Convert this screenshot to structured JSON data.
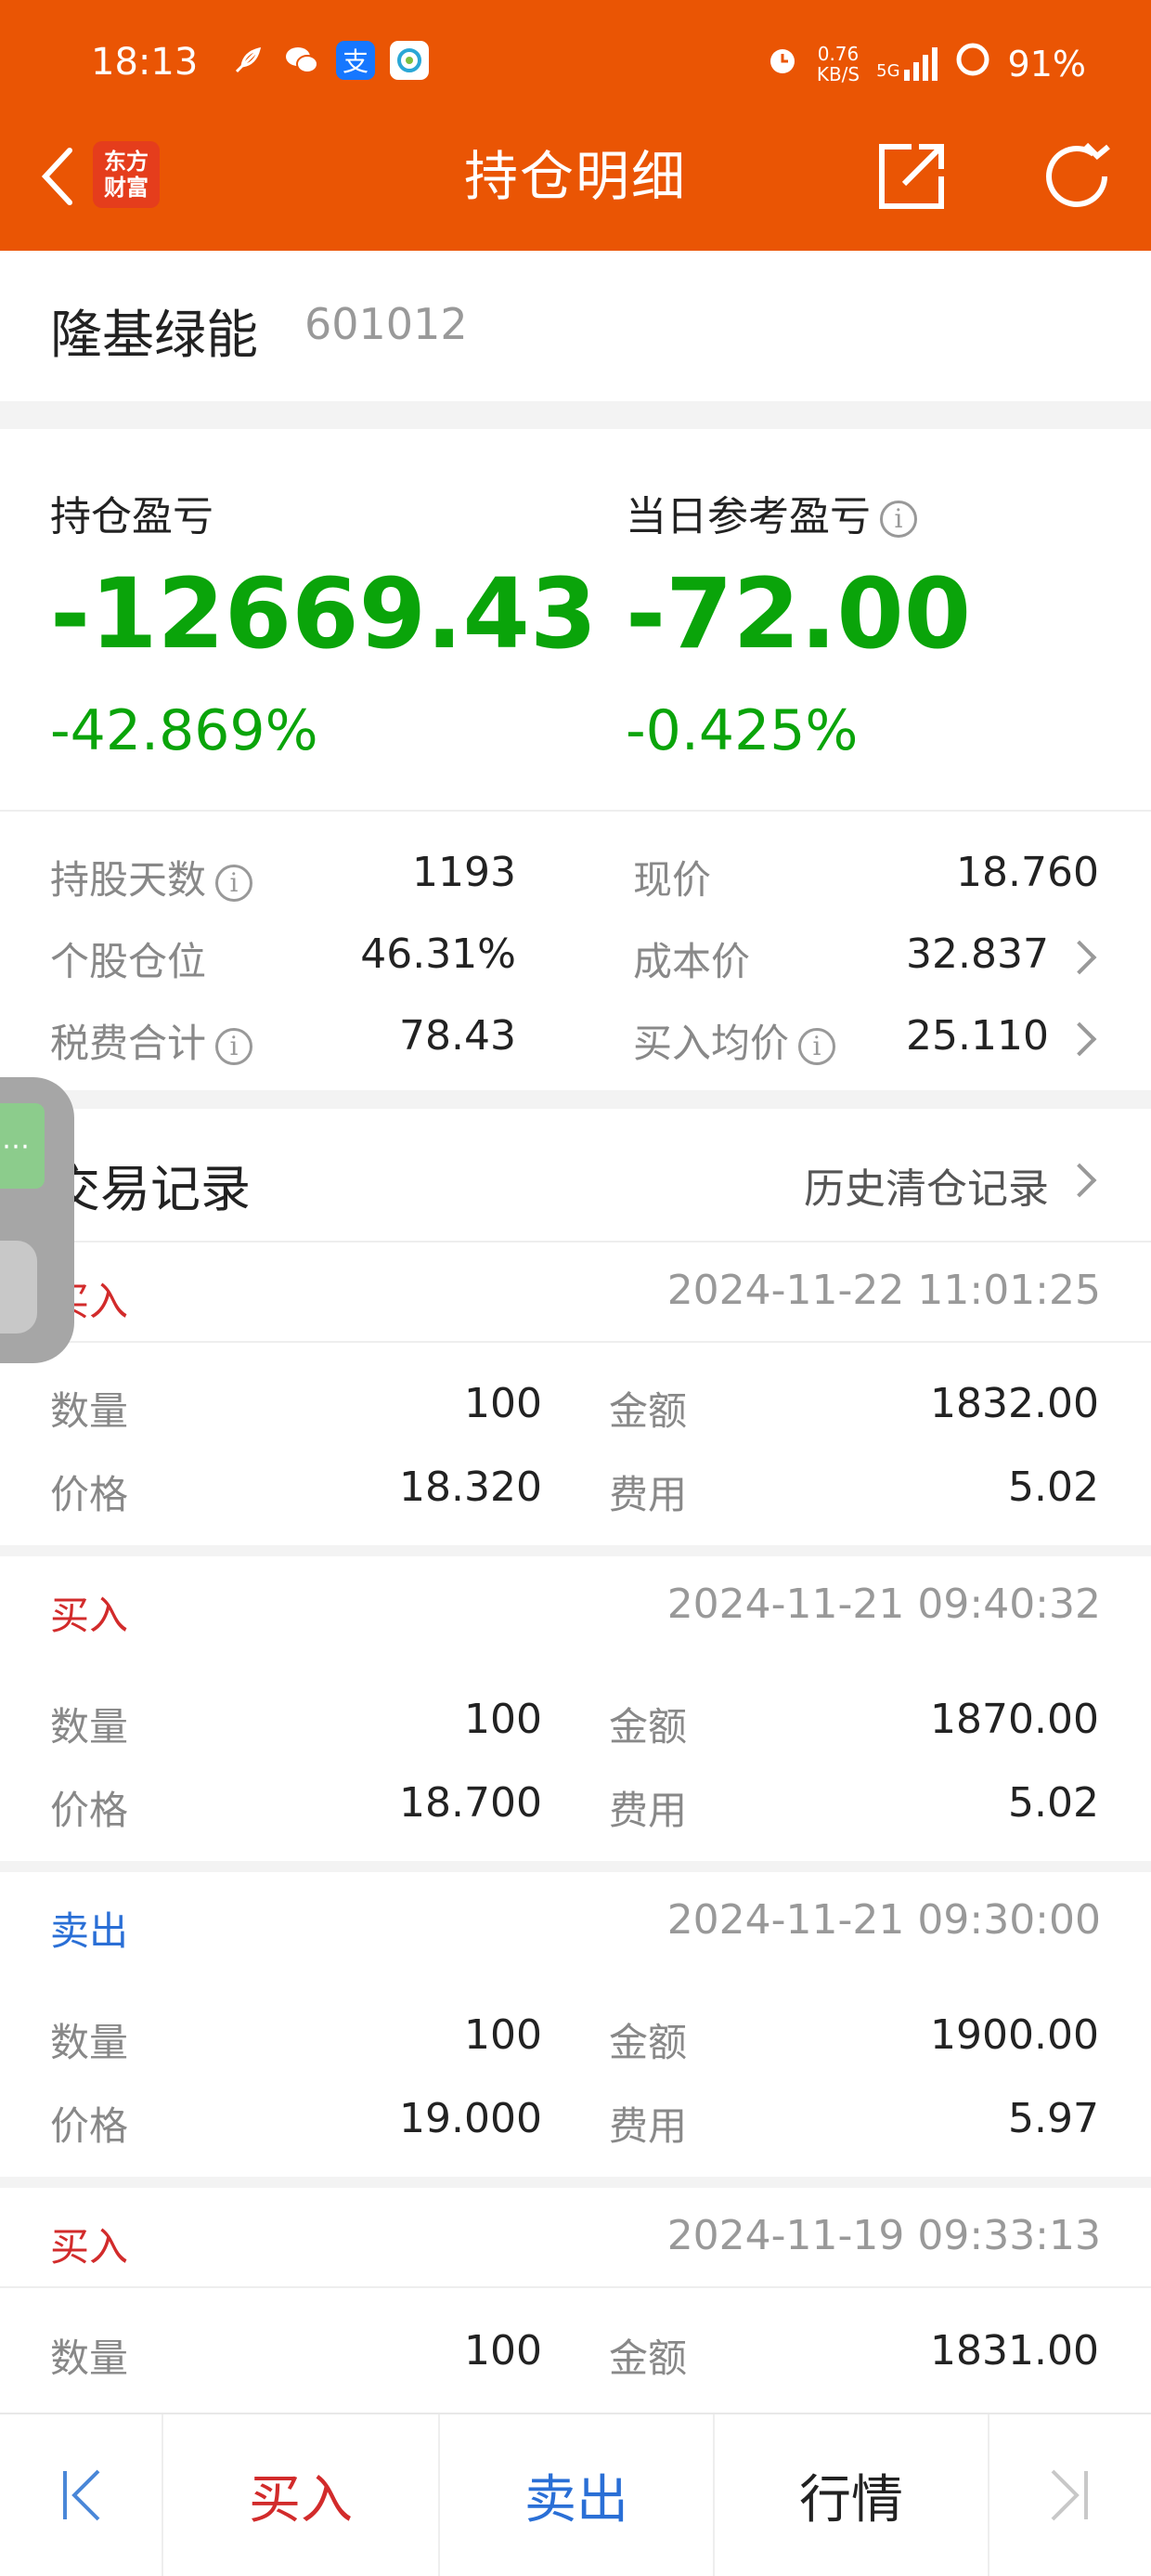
{
  "status": {
    "time": "18:13",
    "net_speed_value": "0.76",
    "net_speed_unit": "KB/S",
    "network": "5G",
    "battery": "91%",
    "alipay": "支"
  },
  "header": {
    "logo_line1": "东方",
    "logo_line2": "财富",
    "title": "持仓明细"
  },
  "stock": {
    "name": "隆基绿能",
    "code": "601012"
  },
  "pnl": {
    "hold_label": "持仓盈亏",
    "hold_value": "-12669.43",
    "hold_pct": "-42.869%",
    "day_label": "当日参考盈亏",
    "day_value": "-72.00",
    "day_pct": "-0.425%"
  },
  "details": {
    "hold_days_label": "持股天数",
    "hold_days_value": "1193",
    "position_label": "个股仓位",
    "position_value": "46.31%",
    "fees_label": "税费合计",
    "fees_value": "78.43",
    "price_label": "现价",
    "price_value": "18.760",
    "cost_label": "成本价",
    "cost_value": "32.837",
    "avg_label": "买入均价",
    "avg_value": "25.110"
  },
  "records": {
    "title": "交易记录",
    "history_link": "历史清仓记录",
    "qty_label": "数量",
    "price_label": "价格",
    "amount_label": "金额",
    "fee_label": "费用",
    "items": [
      {
        "type": "买入",
        "time": "2024-11-22 11:01:25",
        "qty": "100",
        "price": "18.320",
        "amount": "1832.00",
        "fee": "5.02"
      },
      {
        "type": "买入",
        "time": "2024-11-21 09:40:32",
        "qty": "100",
        "price": "18.700",
        "amount": "1870.00",
        "fee": "5.02"
      },
      {
        "type": "卖出",
        "time": "2024-11-21 09:30:00",
        "qty": "100",
        "price": "19.000",
        "amount": "1900.00",
        "fee": "5.97"
      },
      {
        "type": "买入",
        "time": "2024-11-19 09:33:13",
        "qty": "100",
        "amount": "1831.00"
      }
    ]
  },
  "bottom": {
    "buy": "买入",
    "sell": "卖出",
    "market": "行情"
  },
  "colors": {
    "brand": "#ea5504",
    "loss": "#0aa40a",
    "buy": "#d22b2b",
    "sell": "#2a6fd6"
  }
}
